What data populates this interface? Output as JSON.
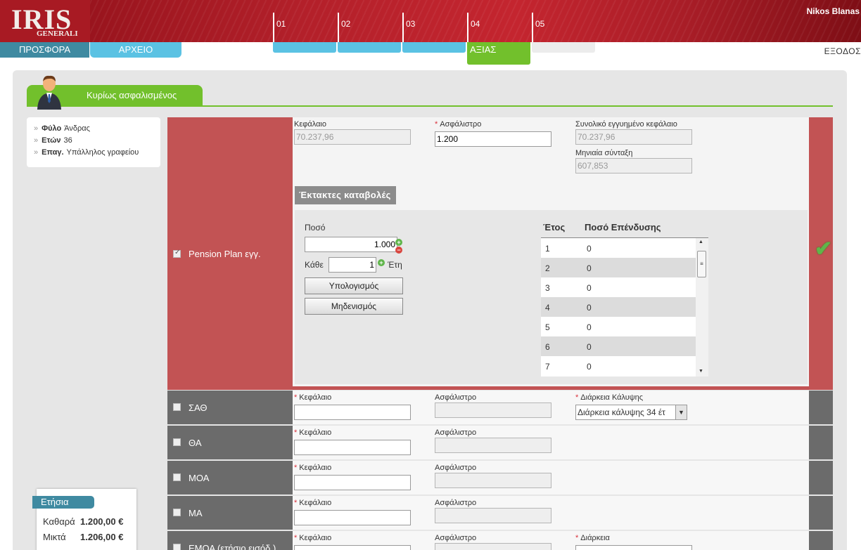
{
  "header": {
    "logo_text": "IRIS",
    "logo_sub": "GENERALI",
    "user_name": "Nikos Blanas",
    "logout": "ΕΞΟΔΟΣ",
    "tabs": [
      {
        "label": "ΠΡΟΣΦΟΡΑ"
      },
      {
        "label": "ΑΡΧΕΙΟ"
      }
    ],
    "steps": [
      {
        "num": "01"
      },
      {
        "num": "02"
      },
      {
        "num": "03"
      },
      {
        "num": "04",
        "label": "ΑΞΙΑΣ"
      },
      {
        "num": "05"
      }
    ]
  },
  "section": {
    "title": "Κυρίως ασφαλισμένος"
  },
  "insured": {
    "gender_label": "Φύλο",
    "gender_value": "Άνδρας",
    "age_label": "Ετών",
    "age_value": "36",
    "occupation_label": "Επαγ.",
    "occupation_value": "Υπάλληλος γραφείου"
  },
  "pension": {
    "name": "Pension Plan εγγ.",
    "capital_label": "Κεφάλαιο",
    "capital_value": "70.237,96",
    "premium_label": "Ασφάλιστρο",
    "premium_value": "1.200",
    "guaranteed_label": "Συνολικό εγγυημένο κεφάλαιο",
    "guaranteed_value": "70.237,96",
    "monthly_label": "Μηνιαία σύνταξη",
    "monthly_value": "607,853",
    "extra_title": "Έκτακτες καταβολές",
    "amount_label": "Ποσό",
    "amount_value": "1.000",
    "every_label": "Κάθε",
    "every_value": "1",
    "years_label": "Έτη",
    "calc_button": "Υπολογισμός",
    "reset_button": "Μηδενισμός",
    "table": {
      "col_year": "Έτος",
      "col_amount": "Ποσό Επένδυσης",
      "rows": [
        {
          "year": "1",
          "amount": "0"
        },
        {
          "year": "2",
          "amount": "0"
        },
        {
          "year": "3",
          "amount": "0"
        },
        {
          "year": "4",
          "amount": "0"
        },
        {
          "year": "5",
          "amount": "0"
        },
        {
          "year": "6",
          "amount": "0"
        },
        {
          "year": "7",
          "amount": "0"
        }
      ]
    }
  },
  "coverages": [
    {
      "name": "ΣΑΘ",
      "capital_label": "Κεφάλαιο",
      "premium_label": "Ασφάλιστρο",
      "duration_label": "Διάρκεια Κάλυψης",
      "duration_value": "Διάρκεια κάλυψης 34 έτ"
    },
    {
      "name": "ΘΑ",
      "capital_label": "Κεφάλαιο",
      "premium_label": "Ασφάλιστρο"
    },
    {
      "name": "ΜΟΑ",
      "capital_label": "Κεφάλαιο",
      "premium_label": "Ασφάλιστρο"
    },
    {
      "name": "ΜΑ",
      "capital_label": "Κεφάλαιο",
      "premium_label": "Ασφάλιστρο"
    },
    {
      "name": "ΕΜΟΑ (ετήσιο εισόδ.)",
      "capital_label": "Κεφάλαιο",
      "premium_label": "Ασφάλιστρο",
      "duration_label": "Διάρκεια"
    }
  ],
  "summary": {
    "tab": "Ετήσια",
    "net_label": "Καθαρά",
    "net_value": "1.200,00 €",
    "gross_label": "Μικτά",
    "gross_value": "1.206,00 €"
  }
}
